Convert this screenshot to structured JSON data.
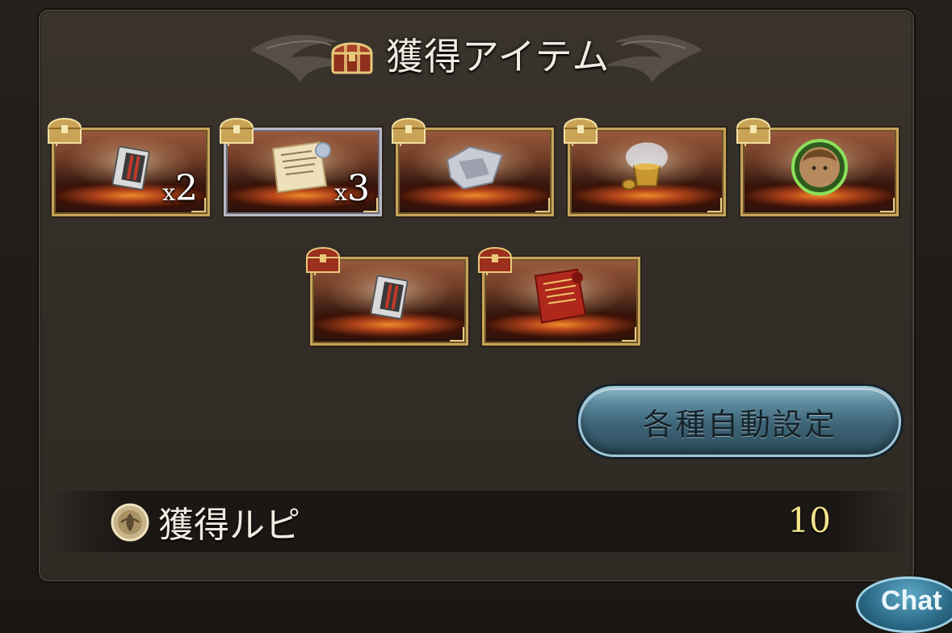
{
  "dialog": {
    "title": "獲得アイテム"
  },
  "items": [
    {
      "name": "dark-ticket-item",
      "quantity_prefix": "x",
      "quantity": "2",
      "frame": "gold"
    },
    {
      "name": "parchment-scroll-item",
      "quantity_prefix": "x",
      "quantity": "3",
      "frame": "silver"
    },
    {
      "name": "silver-shard-item",
      "quantity_prefix": "",
      "quantity": "",
      "frame": "gold"
    },
    {
      "name": "golden-cauldron-item",
      "quantity_prefix": "",
      "quantity": "",
      "frame": "gold"
    },
    {
      "name": "character-orb-item",
      "quantity_prefix": "",
      "quantity": "",
      "frame": "gold"
    },
    {
      "name": "dark-ticket-item-2",
      "quantity_prefix": "",
      "quantity": "",
      "frame": "gold"
    },
    {
      "name": "red-scroll-item",
      "quantity_prefix": "",
      "quantity": "",
      "frame": "gold"
    }
  ],
  "buttons": {
    "auto_settings": "各種自動設定"
  },
  "rupie": {
    "label": "獲得ルピ",
    "value": "10"
  },
  "chat_button": {
    "label": "Chat"
  },
  "colors": {
    "panel_bg": "#332d27",
    "gold_frame": "#c7a35a",
    "silver_frame": "#b9b9c6",
    "button_blue": "#3c6476",
    "rupie_value": "#f5e58a"
  }
}
